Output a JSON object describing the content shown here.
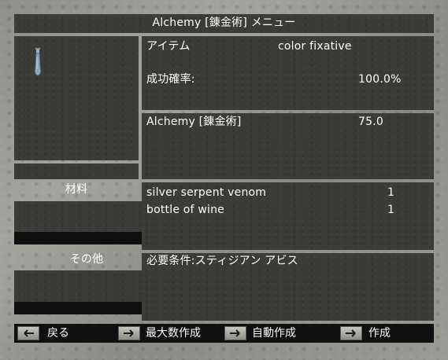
{
  "window": {
    "title": "Alchemy [錬金術] メニュー"
  },
  "item": {
    "label": "アイテム",
    "name": "color fixative",
    "success_label": "成功確率:",
    "success_value": "100.0%",
    "skill_name": "Alchemy [錬金術]",
    "skill_value": "75.0",
    "icon": "potion-bottle-icon"
  },
  "materials": {
    "header": "材料",
    "rows": [
      {
        "name": "silver serpent venom",
        "qty": "1"
      },
      {
        "name": "bottle of wine",
        "qty": "1"
      }
    ]
  },
  "other": {
    "header": "その他",
    "requirement": "必要条件:スティジアン アビス"
  },
  "buttons": {
    "back": "戻る",
    "make_max": "最大数作成",
    "auto_make": "自動作成",
    "make": "作成"
  }
}
